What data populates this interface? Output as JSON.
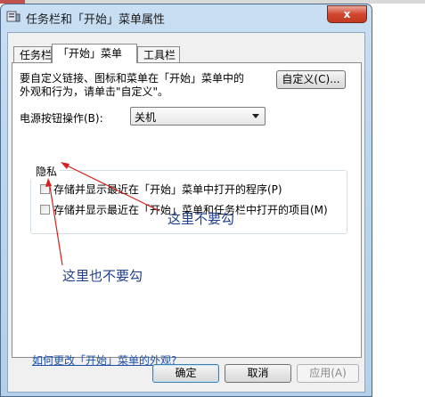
{
  "window": {
    "title": "任务栏和「开始」菜单属性",
    "close_label": "x",
    "app_icon": "taskbar-properties-icon"
  },
  "tabs": [
    {
      "label": "任务栏",
      "active": false
    },
    {
      "label": "「开始」菜单",
      "active": true
    },
    {
      "label": "工具栏",
      "active": false
    }
  ],
  "start_menu": {
    "description_line1": "要自定义链接、图标和菜单在「开始」菜单中的",
    "description_line2": "外观和行为，请单击\"自定义\"。",
    "customize_button": "自定义(C)...",
    "power_button_label": "电源按钮操作(B):",
    "power_button_value": "关机",
    "privacy": {
      "title": "隐私",
      "option1": "存储并显示最近在「开始」菜单中打开的程序(P)",
      "option1_checked": false,
      "option2": "存储并显示最近在「开始」菜单和任务栏中打开的项目(M)",
      "option2_checked": false
    },
    "help_link": "如何更改「开始」菜单的外观?"
  },
  "buttons": {
    "ok": "确定",
    "cancel": "取消",
    "apply": "应用(A)"
  },
  "annotations": {
    "note1": "这里不要勾",
    "note2": "这里也不要勾",
    "arrow_color": "#d42020",
    "text_color": "#1f3f8f"
  }
}
